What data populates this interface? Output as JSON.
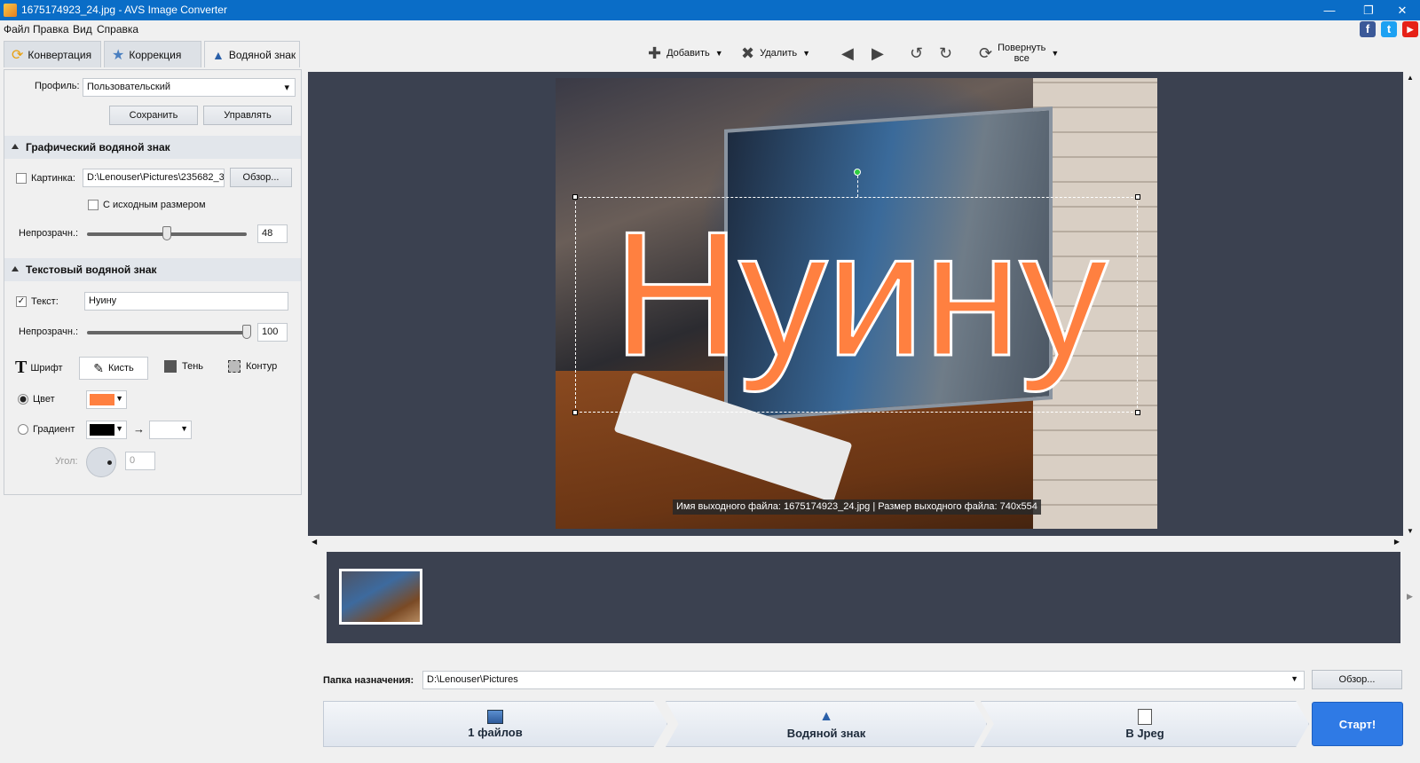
{
  "window": {
    "title": "1675174923_24.jpg - AVS Image Converter"
  },
  "menu": [
    "Файл",
    "Правка",
    "Вид",
    "Справка"
  ],
  "social": {
    "facebook": "f",
    "twitter": "t",
    "youtube": "▶"
  },
  "tabs": [
    {
      "label": "Конвертация",
      "icon": "convert-icon"
    },
    {
      "label": "Коррекция",
      "icon": "star-icon"
    },
    {
      "label": "Водяной знак",
      "icon": "stamp-icon"
    }
  ],
  "profile": {
    "label": "Профиль:",
    "value": "Пользовательский",
    "save": "Сохранить",
    "manage": "Управлять"
  },
  "graphic_wm": {
    "title": "Графический водяной знак",
    "picture_label": "Картинка:",
    "picture_path": "D:\\Lenouser\\Pictures\\235682_3.",
    "browse": "Обзор...",
    "original_size": "С исходным размером",
    "opacity_label": "Непрозрачн.:",
    "opacity_value": "48",
    "opacity_fraction": 0.48
  },
  "text_wm": {
    "title": "Текстовый водяной знак",
    "text_label": "Текст:",
    "text_value": "Нуину",
    "opacity_label": "Непрозрачн.:",
    "opacity_value": "100",
    "opacity_fraction": 1.0,
    "font": "Шрифт",
    "brush": "Кисть",
    "shadow": "Тень",
    "outline": "Контур",
    "color_label": "Цвет",
    "color": "#ff8040",
    "gradient_label": "Градиент",
    "gradient_from": "#000000",
    "gradient_to": "#ffffff",
    "angle_label": "Угол:",
    "angle_value": "0"
  },
  "toolbar": {
    "add": "Добавить",
    "delete": "Удалить",
    "rotate_all": "Повернуть",
    "rotate_all2": "все"
  },
  "preview": {
    "watermark_text": "Нуину",
    "info": "Имя выходного файла: 1675174923_24.jpg | Размер выходного файла: 740x554"
  },
  "destination": {
    "label": "Папка назначения:",
    "path": "D:\\Lenouser\\Pictures",
    "browse": "Обзор..."
  },
  "steps": [
    {
      "label": "1 файлов",
      "icon": "image-icon"
    },
    {
      "label": "Водяной знак",
      "icon": "stamp-icon"
    },
    {
      "label": "В Jpeg",
      "icon": "jpeg-icon"
    }
  ],
  "start": "Старт!"
}
